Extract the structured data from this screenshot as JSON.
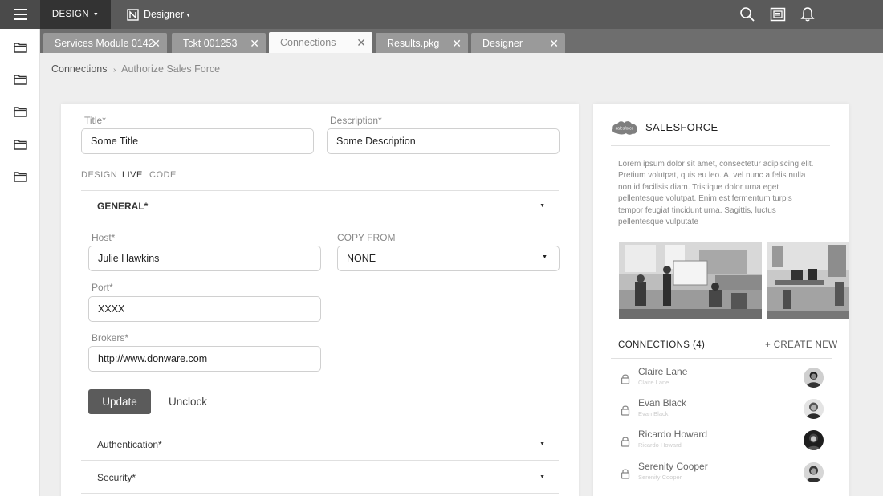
{
  "topbar": {
    "module_label": "DESIGN",
    "app_label": "Designer"
  },
  "tabs": [
    {
      "label": "Services Module 0142",
      "active": false
    },
    {
      "label": "Tckt 001253",
      "active": false
    },
    {
      "label": "Connections",
      "active": true
    },
    {
      "label": "Results.pkg",
      "active": false
    },
    {
      "label": "Designer",
      "active": false
    }
  ],
  "breadcrumb": {
    "parent": "Connections",
    "separator": "›",
    "current": "Authorize Sales Force"
  },
  "form": {
    "title_label": "Title*",
    "title_value": "Some Title",
    "description_label": "Description*",
    "description_value": "Some Description",
    "modes": [
      "DESIGN",
      "LIVE",
      "CODE"
    ],
    "active_mode": "LIVE",
    "general_label": "GENERAL*",
    "host_label": "Host*",
    "host_value": "Julie Hawkins",
    "copy_from_label": "COPY FROM",
    "copy_from_value": "NONE",
    "port_label": "Port*",
    "port_value": "XXXX",
    "brokers_label": "Brokers*",
    "brokers_value": "http://www.donware.com",
    "update_label": "Update",
    "unclock_label": "Unclock",
    "authentication_label": "Authentication*",
    "security_label": "Security*"
  },
  "side": {
    "logo_text": "salesforce",
    "title": "SALESFORCE",
    "description": "Lorem ipsum dolor sit amet, consectetur adipiscing elit. Pretium volutpat, quis eu leo. A, vel nunc a felis nulla non id facilisis diam. Tristique dolor urna eget pellentesque volutpat. Enim est fermentum turpis tempor feugiat tincidunt urna. Sagittis, luctus pellentesque vulputate",
    "connections_label": "CONNECTIONS (4)",
    "create_new_label": "+ CREATE NEW",
    "connections": [
      {
        "name": "Claire Lane",
        "sub": "Claire Lane"
      },
      {
        "name": "Evan Black",
        "sub": "Evan Black"
      },
      {
        "name": "Ricardo Howard",
        "sub": "Ricardo Howard"
      },
      {
        "name": "Serenity Cooper",
        "sub": "Serenity Cooper"
      }
    ]
  },
  "icons": {
    "menu": "hamburger-icon",
    "app": "designer-app-icon",
    "search": "search-icon",
    "gallery": "gallery-icon",
    "notifications": "bell-icon",
    "folder": "folder-icon",
    "lock": "lock-icon"
  },
  "colors": {
    "topbar": "#5a5a5a",
    "module_switch": "#333333",
    "tabbar": "#6e6e6e",
    "tab_inactive": "#9a9a9a",
    "button_primary": "#5b5b5b",
    "background": "#eeeeee"
  }
}
